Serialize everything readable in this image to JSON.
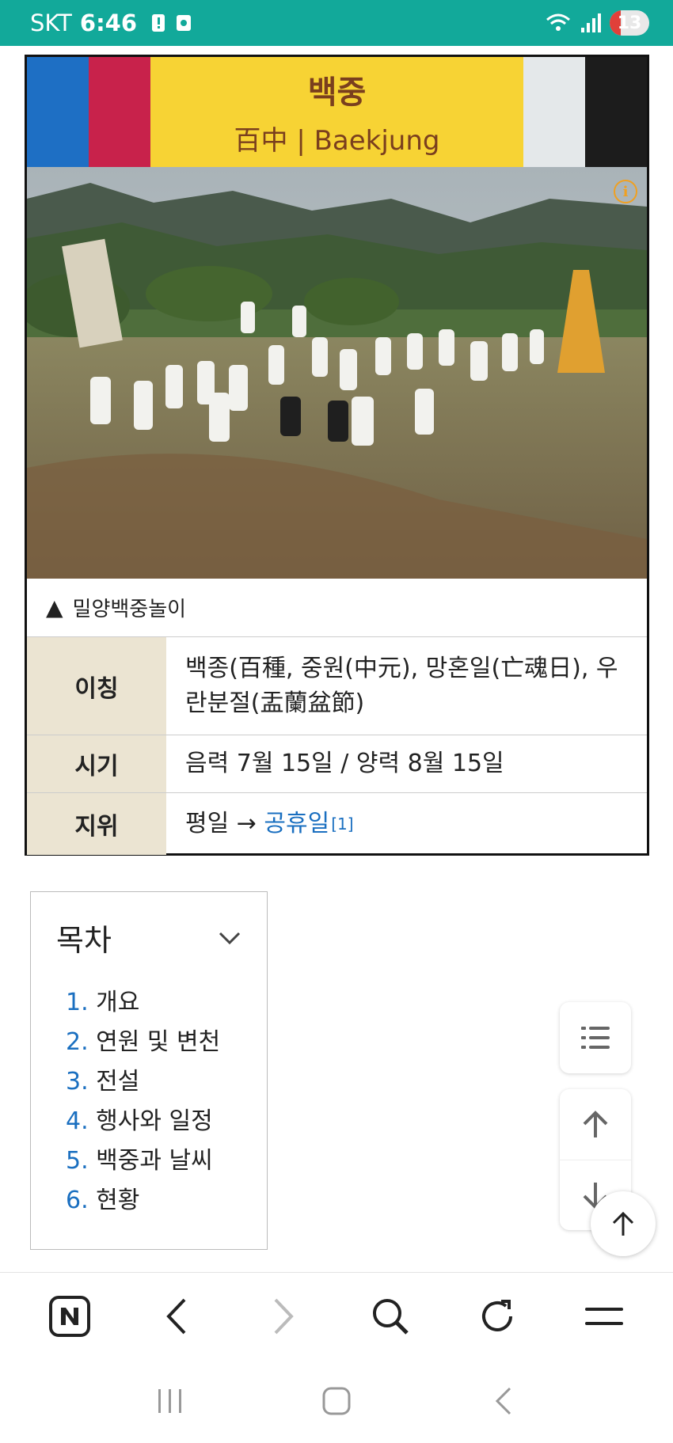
{
  "status_bar": {
    "carrier": "SKT",
    "time": "6:46",
    "battery": "13",
    "background": "#12a99a"
  },
  "infobox": {
    "title": "백중",
    "subtitle": "百中 | Baekjung",
    "stripe_colors": [
      "#1e6fc4",
      "#c8224b",
      "#f7d334",
      "#e4e8ea",
      "#1c1c1c"
    ],
    "caption_marker": "▲",
    "caption": "밀양백중놀이",
    "rows": [
      {
        "label": "이칭",
        "value": "백종(百種, 중원(中元), 망혼일(亡魂日), 우란분절(盂蘭盆節)"
      },
      {
        "label": "시기",
        "value": "음력 7월 15일 / 양력 8월 15일"
      },
      {
        "label": "지위",
        "value_prefix": "평일 → ",
        "link": "공휴일",
        "ref": "[1]"
      }
    ]
  },
  "toc": {
    "title": "목차",
    "items": [
      {
        "num": "1.",
        "label": "개요"
      },
      {
        "num": "2.",
        "label": "연원 및 변천"
      },
      {
        "num": "3.",
        "label": "전설"
      },
      {
        "num": "4.",
        "label": "행사와 일정"
      },
      {
        "num": "5.",
        "label": "백중과 날씨"
      },
      {
        "num": "6.",
        "label": "현황"
      }
    ]
  },
  "icons": {
    "floating": [
      "list-icon",
      "arrow-up-icon",
      "arrow-down-icon",
      "scroll-top-icon"
    ],
    "browser_bar": [
      "naver-logo-icon",
      "back-chevron-icon",
      "forward-chevron-icon",
      "search-icon",
      "refresh-icon",
      "menu-icon"
    ],
    "android_nav": [
      "recents-icon",
      "home-icon",
      "back-icon"
    ]
  },
  "colors": {
    "link": "#1a6fc0",
    "label_bg": "#ebe4d2",
    "title_text": "#7a3f1e"
  }
}
